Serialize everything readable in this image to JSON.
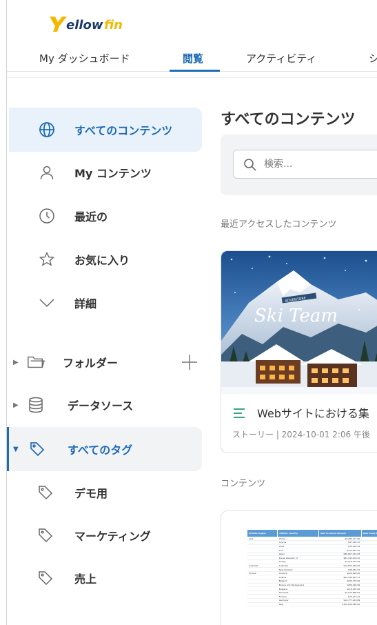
{
  "app": {
    "logo_text": "Yellowfin"
  },
  "nav": {
    "tabs": [
      {
        "label": "My ダッシュボード"
      },
      {
        "label": "閲覧"
      },
      {
        "label": "アクティビティ"
      },
      {
        "label": "シ"
      }
    ],
    "active_tab": "閲覧"
  },
  "sidebar": {
    "items": [
      {
        "label": "すべてのコンテンツ",
        "icon": "globe-icon"
      },
      {
        "label": "My コンテンツ",
        "icon": "user-icon"
      },
      {
        "label": "最近の",
        "icon": "clock-icon"
      },
      {
        "label": "お気に入り",
        "icon": "star-icon"
      },
      {
        "label": "詳細",
        "icon": "chevron-down-icon"
      }
    ],
    "tree": [
      {
        "label": "フォルダー",
        "icon": "folder-icon"
      },
      {
        "label": "データソース",
        "icon": "database-icon"
      },
      {
        "label": "すべてのタグ",
        "icon": "tag-icon"
      }
    ],
    "tags": [
      {
        "label": "デモ用"
      },
      {
        "label": "マーケティング"
      },
      {
        "label": "売上"
      }
    ]
  },
  "main": {
    "title": "すべてのコンテンツ",
    "search_placeholder": "検索...",
    "recent_label": "最近アクセスしたコンテンツ",
    "content_label": "コンテンツ",
    "recent_card": {
      "image_text": "Ski Team",
      "image_banner": "ADVENTURE",
      "title": "Webサイトにおける集",
      "meta": "ストーリー | 2024-10-01 2:06 午後"
    },
    "content_card": {
      "headers": [
        "Athlete Region",
        "Athlete Country",
        "Sum Invoiced Amount",
        "Sum Camp Fee"
      ],
      "rows": [
        [
          "Asia",
          "China",
          "$3,285,117.60",
          "$"
        ],
        [
          "",
          "Cyprus",
          "$47,395.32",
          ""
        ],
        [
          "",
          "India",
          "$34,923.94",
          ""
        ],
        [
          "",
          "Iran",
          "$132,697.40",
          ""
        ],
        [
          "",
          "Japan",
          "$86,667,244.08",
          "$"
        ],
        [
          "",
          "Korea, Republic of",
          "$81,192,903.25",
          "$"
        ],
        [
          "",
          "Turkey",
          "$4,219,374.94",
          ""
        ],
        [
          "Australia",
          "Australia",
          "$12,802,026.09",
          "$"
        ],
        [
          "",
          "New Zealand",
          "$36,061.53",
          ""
        ],
        [
          "Europe",
          "Andorra",
          "$229,428.45",
          ""
        ],
        [
          "",
          "Austria",
          "$93,449,919.11",
          "$"
        ],
        [
          "",
          "Belgium",
          "$295,770.99",
          ""
        ],
        [
          "",
          "Bosnia and Herzegovina",
          "$280,026.99",
          ""
        ],
        [
          "",
          "Bulgaria",
          "$215,387.06",
          ""
        ],
        [
          "",
          "Denmark",
          "$2,974,899.64",
          ""
        ],
        [
          "",
          "Finland",
          "$75,471.41",
          ""
        ],
        [
          "",
          "Germany",
          "$12,777,219.89",
          "$"
        ],
        [
          "",
          "Italy",
          "$152,840,285.00",
          ""
        ]
      ]
    }
  },
  "colors": {
    "accent": "#1f6bb5",
    "active_bg": "#e9f2fb",
    "logo_yellow": "#f5b800",
    "logo_navy": "#1b3a6b"
  }
}
